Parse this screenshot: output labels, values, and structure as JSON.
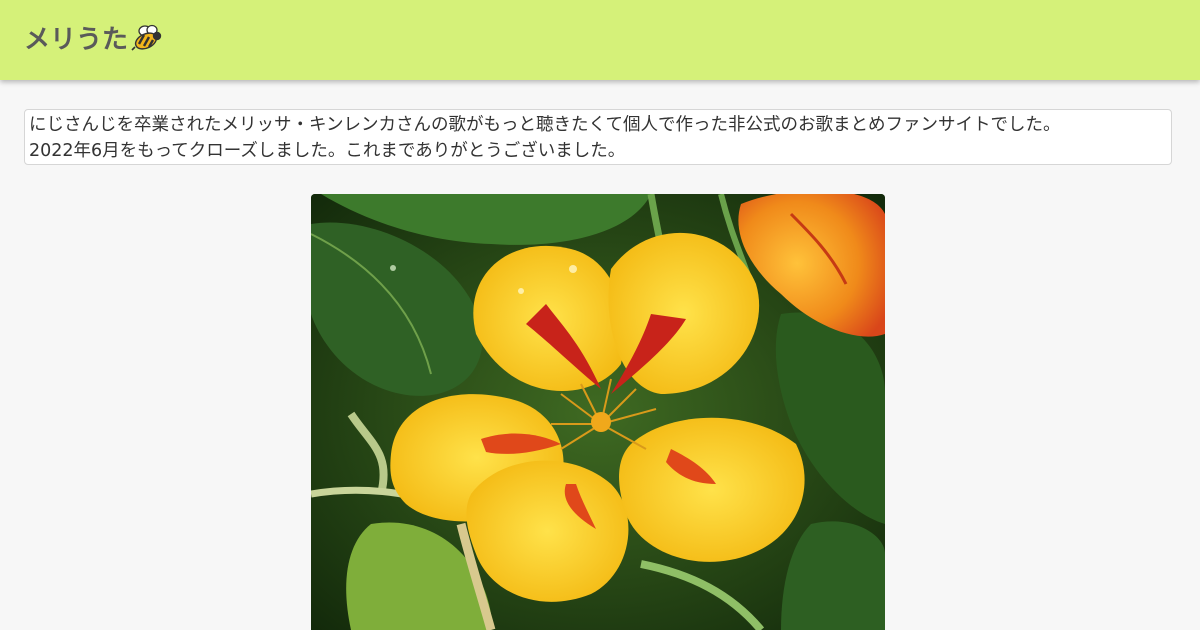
{
  "header": {
    "site_title": "メリうた",
    "logo_icon": "bee-icon",
    "background_color": "#d5f179"
  },
  "notice": {
    "line1": "にじさんじを卒業されたメリッサ・キンレンカさんの歌がもっと聴きたくて個人で作った非公式のお歌まとめファンサイトでした。",
    "line2": "2022年6月をもってクローズしました。これまでありがとうございました。"
  },
  "hero_image": {
    "icon": "nasturtium-flower-photo"
  }
}
